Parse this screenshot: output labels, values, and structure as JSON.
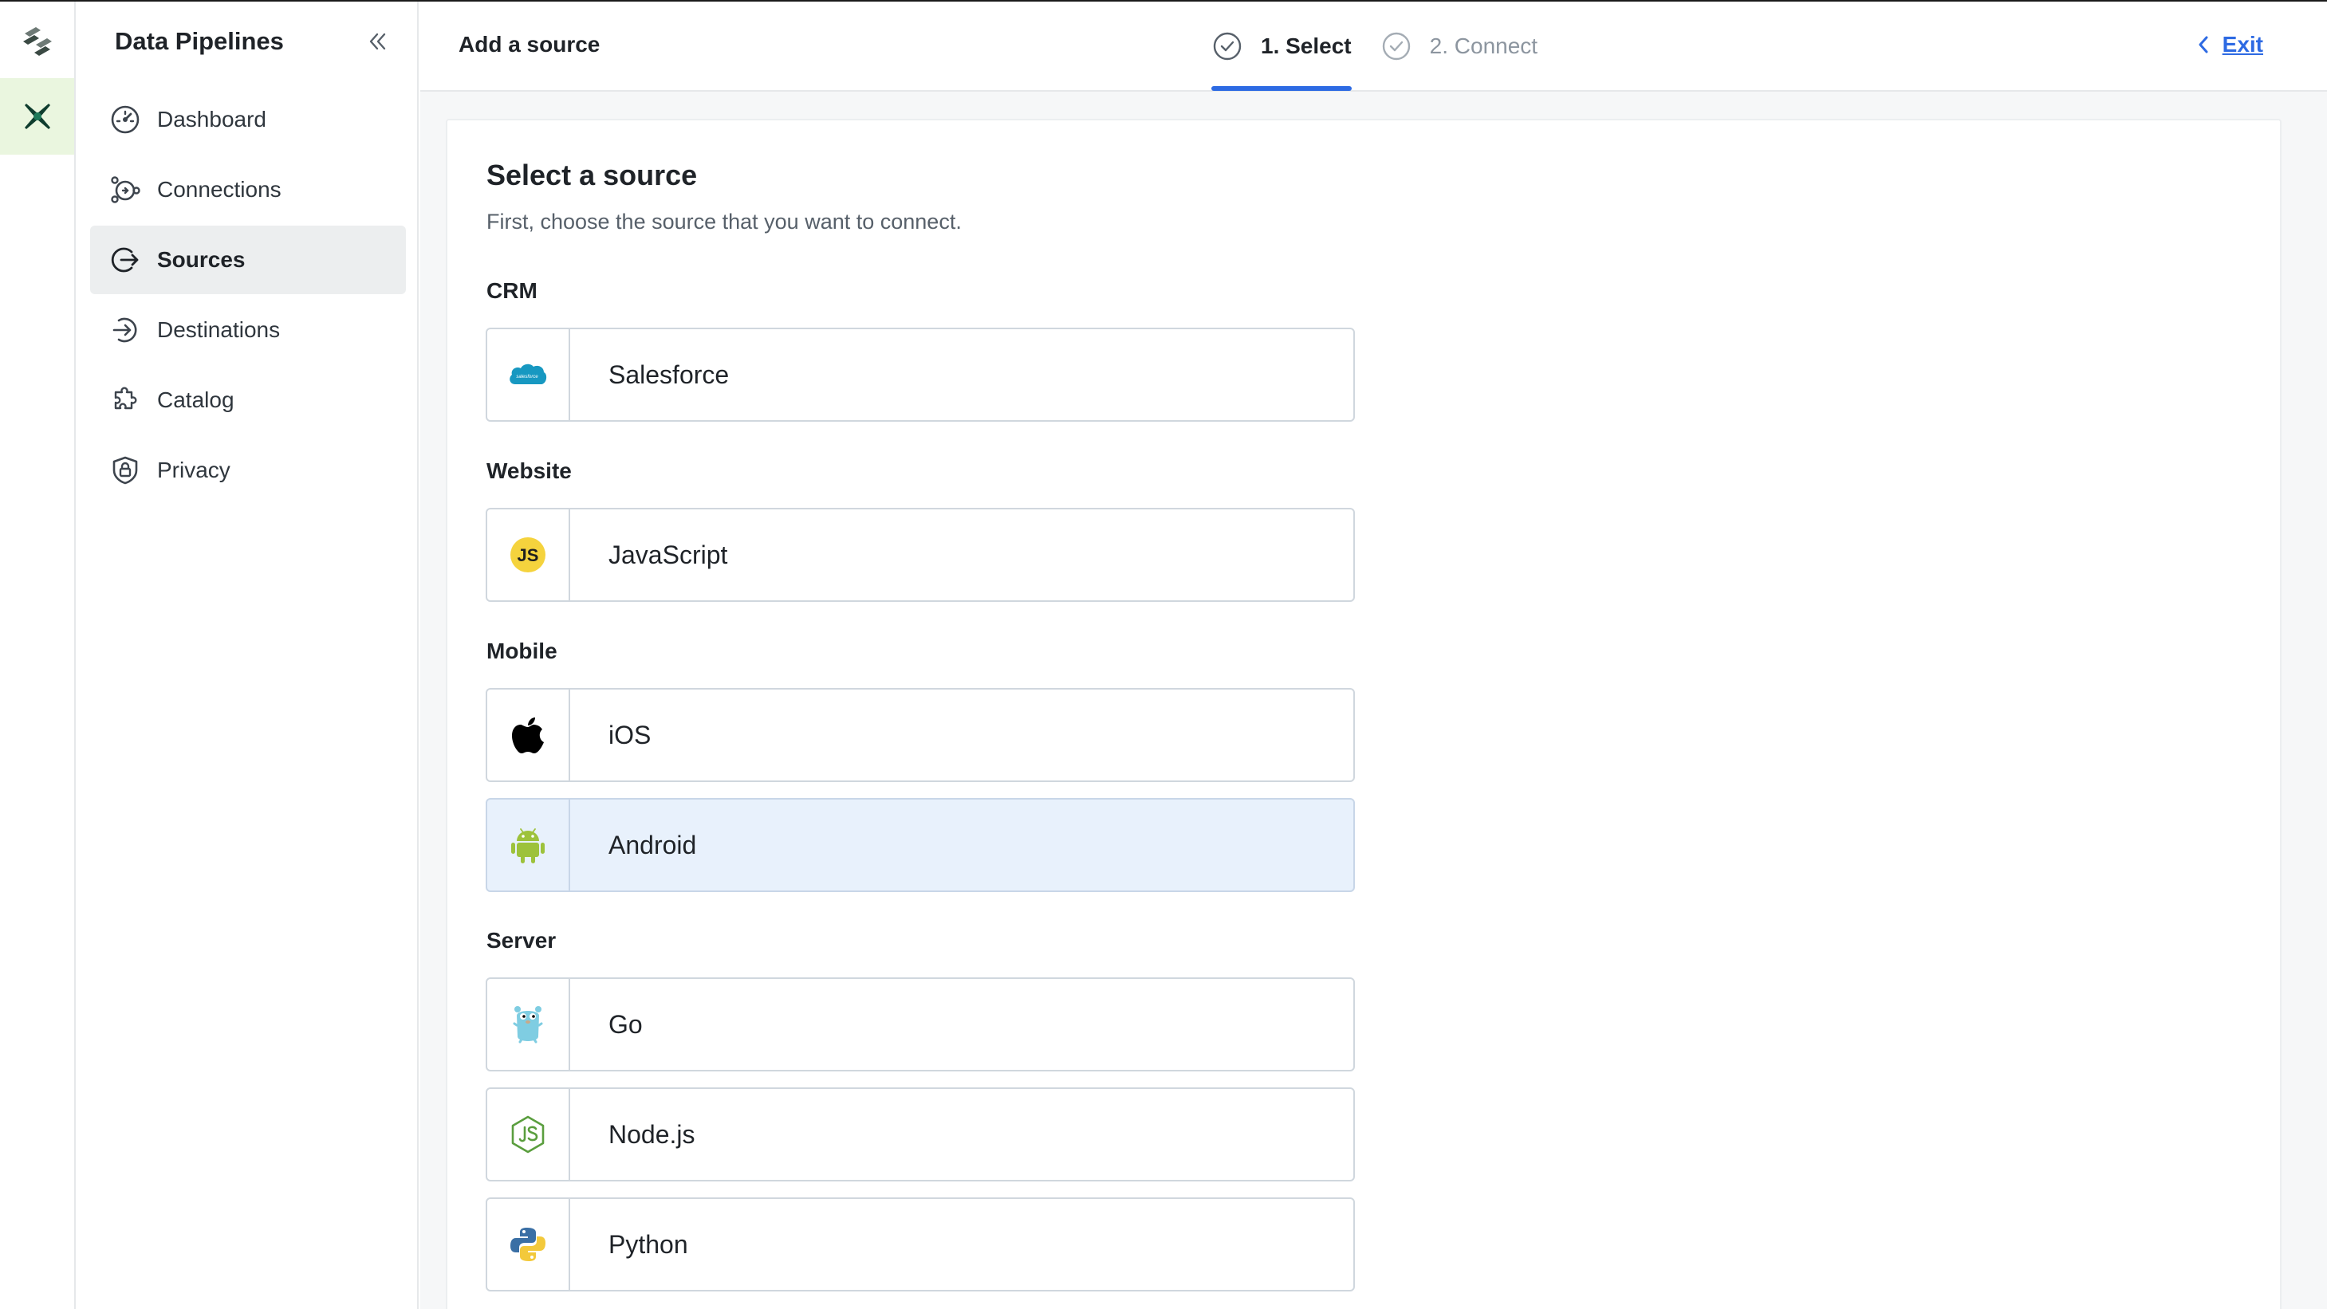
{
  "app": {
    "sidebar_title": "Data Pipelines"
  },
  "nav": [
    {
      "label": "Dashboard",
      "icon": "gauge-icon"
    },
    {
      "label": "Connections",
      "icon": "connections-icon"
    },
    {
      "label": "Sources",
      "icon": "sources-icon",
      "active": true
    },
    {
      "label": "Destinations",
      "icon": "destinations-icon"
    },
    {
      "label": "Catalog",
      "icon": "catalog-icon"
    },
    {
      "label": "Privacy",
      "icon": "shield-lock-icon"
    }
  ],
  "topbar": {
    "title": "Add a source",
    "steps": [
      {
        "label": "1. Select",
        "state": "current"
      },
      {
        "label": "2. Connect",
        "state": "pending"
      }
    ],
    "exit_label": "Exit"
  },
  "main": {
    "title": "Select a source",
    "subtitle": "First, choose the source that you want to connect.",
    "groups": [
      {
        "label": "CRM",
        "sources": [
          {
            "label": "Salesforce",
            "icon": "salesforce-icon",
            "logo_text": "salesforce"
          }
        ]
      },
      {
        "label": "Website",
        "sources": [
          {
            "label": "JavaScript",
            "icon": "javascript-icon",
            "logo_text": "JS"
          }
        ]
      },
      {
        "label": "Mobile",
        "sources": [
          {
            "label": "iOS",
            "icon": "apple-icon"
          },
          {
            "label": "Android",
            "icon": "android-icon"
          }
        ]
      },
      {
        "label": "Server",
        "sources": [
          {
            "label": "Go",
            "icon": "go-gopher-icon"
          },
          {
            "label": "Node.js",
            "icon": "nodejs-icon"
          },
          {
            "label": "Python",
            "icon": "python-icon"
          }
        ]
      }
    ]
  },
  "colors": {
    "accent": "#2d6ae3",
    "rail_active_bg": "#eaf6df",
    "hover_tile_bg": "#e8f1fc",
    "brand_dark": "#0f3d2e"
  }
}
